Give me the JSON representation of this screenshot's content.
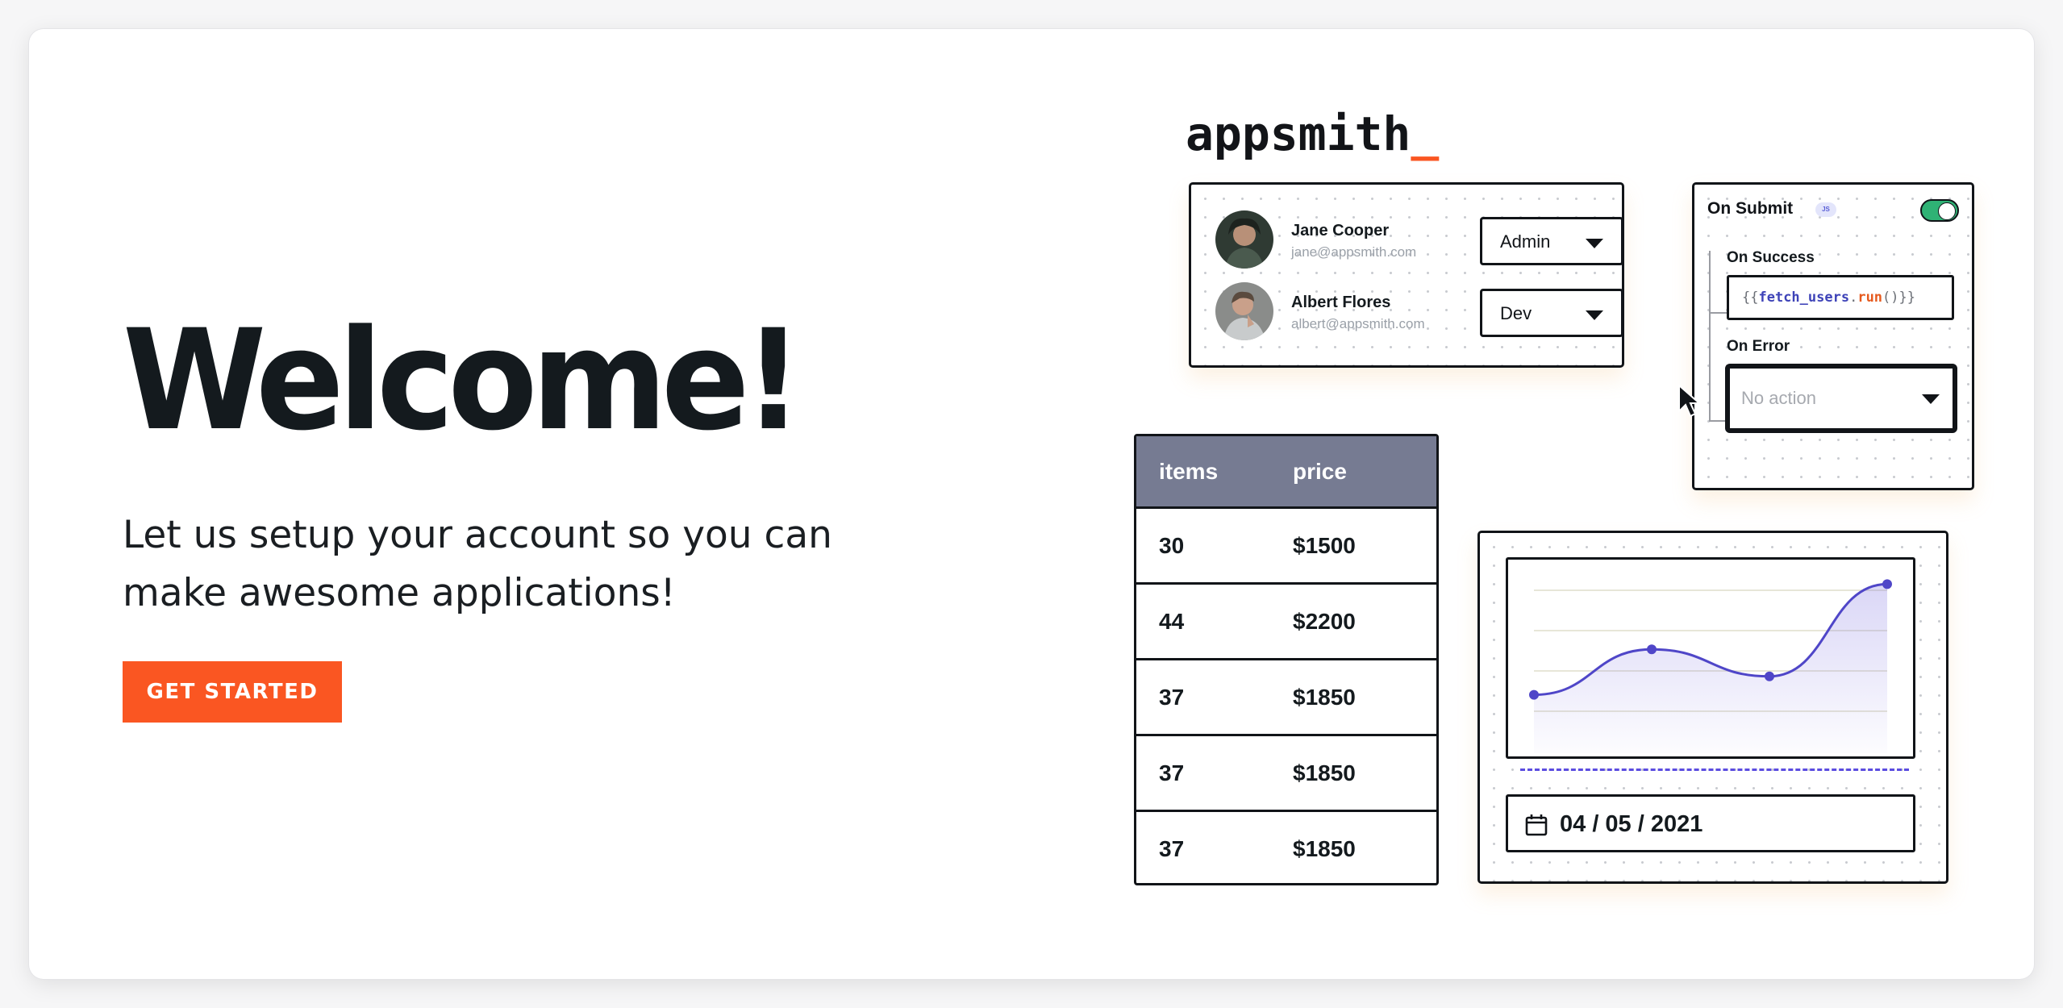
{
  "hero": {
    "title": "Welcome!",
    "subtitle": "Let us setup your account so you can make awesome applications!",
    "cta_label": "GET STARTED"
  },
  "brand": {
    "logo_text": "appsmith",
    "logo_cursor": "_",
    "accent": "#fa5622"
  },
  "users": [
    {
      "name": "Jane Cooper",
      "email": "jane@appsmith.com",
      "role": "Admin"
    },
    {
      "name": "Albert Flores",
      "email": "albert@appsmith.com",
      "role": "Dev"
    }
  ],
  "submit_panel": {
    "title": "On Submit",
    "badge": "JS",
    "toggle_on": true,
    "on_success_label": "On Success",
    "on_success_code": {
      "open": "{{",
      "fn": "fetch_users",
      "dot": ".",
      "method": "run",
      "close": "()}}"
    },
    "on_error_label": "On Error",
    "on_error_placeholder": "No action"
  },
  "table": {
    "headers": [
      "items",
      "price"
    ],
    "rows": [
      [
        "30",
        "$1500"
      ],
      [
        "44",
        "$2200"
      ],
      [
        "37",
        "$1850"
      ],
      [
        "37",
        "$1850"
      ],
      [
        "37",
        "$1850"
      ]
    ],
    "header_color": "#767b92"
  },
  "date_picker": {
    "value": "04 / 05 / 2021"
  },
  "chart_data": {
    "type": "line",
    "x": [
      0,
      1,
      2,
      3
    ],
    "values": [
      0.15,
      0.47,
      0.28,
      0.93
    ],
    "title": "",
    "xlabel": "",
    "ylabel": "",
    "ylim": [
      0,
      1
    ],
    "grid": true,
    "line_color": "#4f46c8"
  }
}
